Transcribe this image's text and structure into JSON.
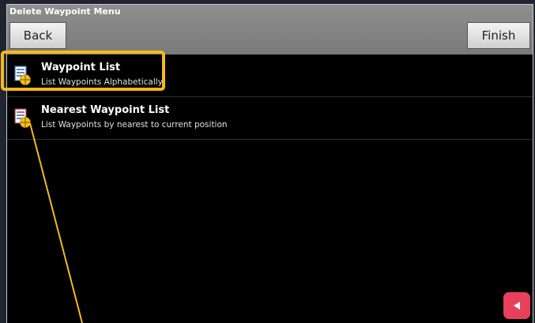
{
  "window": {
    "title": "Delete Waypoint Menu"
  },
  "toolbar": {
    "back_label": "Back",
    "finish_label": "Finish"
  },
  "menu": {
    "items": [
      {
        "title": "Waypoint List",
        "subtitle": "List Waypoints Alphabetically",
        "icon": "waypoint-list-icon",
        "highlighted": true
      },
      {
        "title": "Nearest Waypoint List",
        "subtitle": "List Waypoints by nearest to current position",
        "icon": "nearest-waypoint-list-icon",
        "highlighted": false
      }
    ]
  },
  "colors": {
    "highlight": "#f6b91b",
    "corner_button": "#e8405a",
    "titlebar": "#8a8a8a"
  }
}
